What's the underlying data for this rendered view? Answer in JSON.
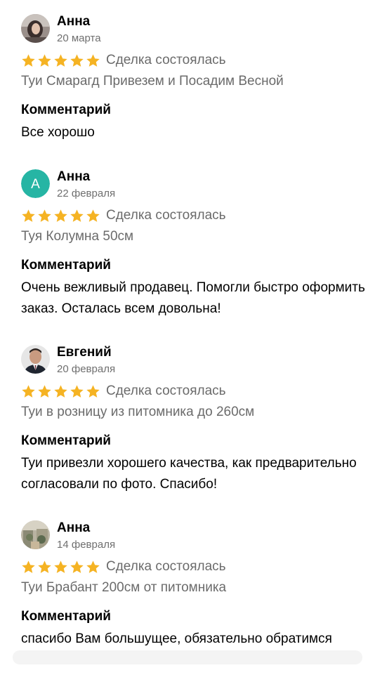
{
  "reviews": [
    {
      "name": "Анна",
      "date": "20 марта",
      "rating": 5,
      "deal_status": "Сделка состоялась",
      "item": "Туи Смарагд Привезем и Посадим Весной",
      "comment_label": "Комментарий",
      "comment": "Все хорошо",
      "avatar": "photo"
    },
    {
      "name": "Анна",
      "date": "22 февраля",
      "rating": 5,
      "deal_status": "Сделка состоялась",
      "item": "Туя Колумна 50см",
      "comment_label": "Комментарий",
      "comment": "Очень вежливый продавец. Помогли быстро оформить заказ. Осталась всем довольна!",
      "avatar": "letter",
      "avatar_letter": "А",
      "avatar_color": "#26b5a4"
    },
    {
      "name": "Евгений",
      "date": "20 февраля",
      "rating": 5,
      "deal_status": "Сделка состоялась",
      "item": "Туи в розницу из питомника до 260см",
      "comment_label": "Комментарий",
      "comment": "Туи привезли хорошего качества, как предварительно согласовали по фото. Спасибо!",
      "avatar": "photo"
    },
    {
      "name": "Анна",
      "date": "14 февраля",
      "rating": 5,
      "deal_status": "Сделка состоялась",
      "item": "Туи Брабант 200см от питомника",
      "comment_label": "Комментарий",
      "comment": "спасибо Вам большущее, обязательно обратимся",
      "avatar": "photo"
    }
  ],
  "colors": {
    "star": "#f5b323",
    "secondary_text": "#6b6b6b",
    "date_text": "#6f6f6f"
  },
  "icons": {
    "star": "star-icon"
  }
}
